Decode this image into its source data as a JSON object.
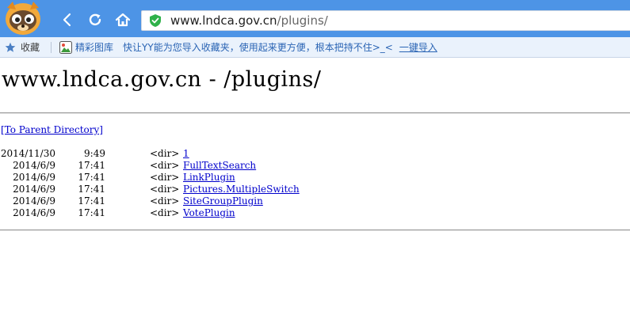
{
  "browser": {
    "url_host": "www.lndca.gov.cn",
    "url_path": "/plugins/",
    "bookmarks_bar": {
      "favorites_label": "收藏",
      "picture_library_label": "精彩图库",
      "import_hint": "快让YY能为您导入收藏夹，使用起来更方便，根本把持不住>_<",
      "import_link": "一键导入"
    },
    "icons": {
      "logo": "browser-mascot-icon",
      "back": "back-arrow-icon",
      "refresh": "refresh-icon",
      "home": "home-icon",
      "security": "shield-check-icon",
      "favorites": "star-icon",
      "pictures": "picture-icon"
    },
    "colors": {
      "toolbar": "#4d94e6",
      "bookmarks_bar": "#eaf2fc",
      "shield": "#2fb14a",
      "link": "#0000cc"
    }
  },
  "page": {
    "title": "www.lndca.gov.cn - /plugins/",
    "parent_link": "[To Parent Directory]",
    "entries": [
      {
        "date": "2014/11/30",
        "time": "9:49",
        "type": "<dir>",
        "name": "1"
      },
      {
        "date": "2014/6/9",
        "time": "17:41",
        "type": "<dir>",
        "name": "FullTextSearch"
      },
      {
        "date": "2014/6/9",
        "time": "17:41",
        "type": "<dir>",
        "name": "LinkPlugin"
      },
      {
        "date": "2014/6/9",
        "time": "17:41",
        "type": "<dir>",
        "name": "Pictures.MultipleSwitch"
      },
      {
        "date": "2014/6/9",
        "time": "17:41",
        "type": "<dir>",
        "name": "SiteGroupPlugin"
      },
      {
        "date": "2014/6/9",
        "time": "17:41",
        "type": "<dir>",
        "name": "VotePlugin"
      }
    ]
  }
}
